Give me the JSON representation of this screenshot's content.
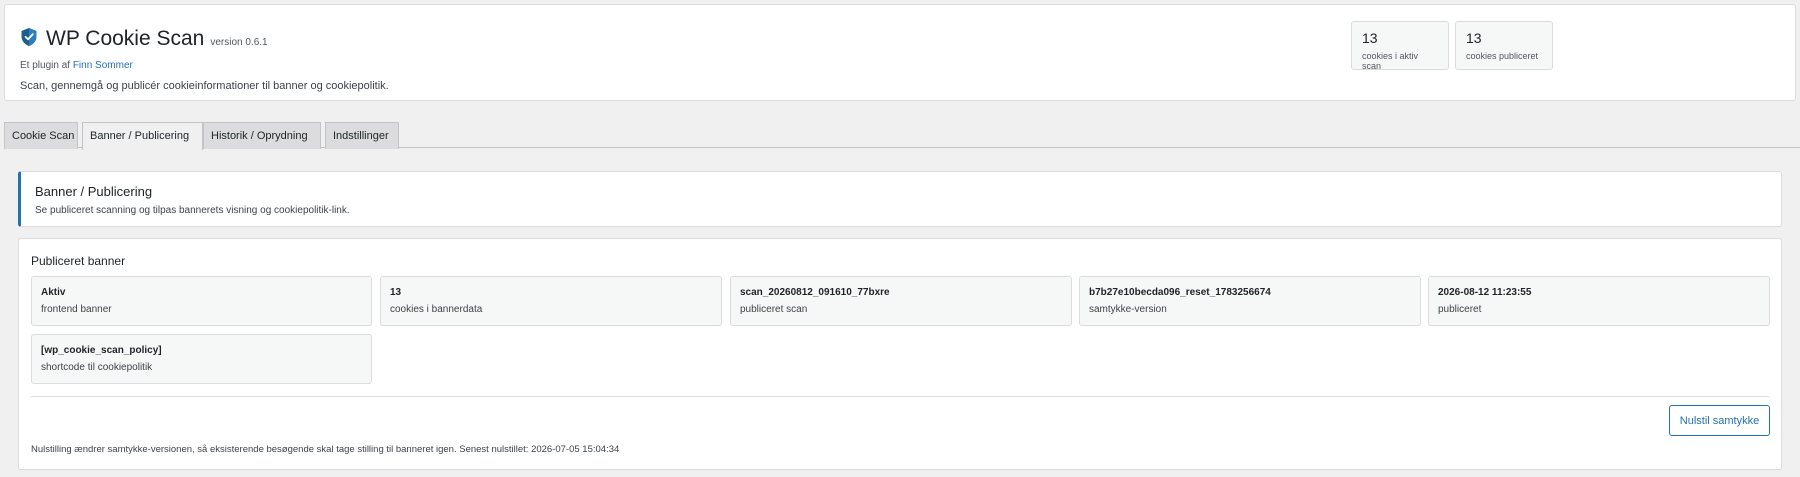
{
  "header": {
    "title": "WP Cookie Scan",
    "version": "version 0.6.1",
    "byline_prefix": "Et plugin af",
    "author": "Finn Sommer",
    "tagline": "Scan, gennemgå og publicér cookieinformationer til banner og cookiepolitik.",
    "icon": "shield-icon",
    "brand_color": "#2271b1"
  },
  "stats": [
    {
      "value": "13",
      "label": "cookies i aktiv scan"
    },
    {
      "value": "13",
      "label": "cookies publiceret"
    }
  ],
  "tabs": [
    {
      "label": "Cookie Scan"
    },
    {
      "label": "Banner / Publicering"
    },
    {
      "label": "Historik / Oprydning"
    },
    {
      "label": "Indstillinger"
    }
  ],
  "active_tab": "Banner / Publicering",
  "section": {
    "title": "Banner / Publicering",
    "description": "Se publiceret scanning og tilpas bannerets visning og cookiepolitik-link."
  },
  "published": {
    "title": "Publiceret banner",
    "tiles": [
      {
        "value": "Aktiv",
        "label": "frontend banner"
      },
      {
        "value": "13",
        "label": "cookies i bannerdata"
      },
      {
        "value": "scan_20260812_091610_77bxre",
        "label": "publiceret scan"
      },
      {
        "value": "b7b27e10becda096_reset_1783256674",
        "label": "samtykke-version"
      },
      {
        "value": "2026-08-12 11:23:55",
        "label": "publiceret"
      },
      {
        "value": "[wp_cookie_scan_policy]",
        "label": "shortcode til cookiepolitik"
      }
    ],
    "reset_button": "Nulstil samtykke",
    "note": "Nulstilling ændrer samtykke-versionen, så eksisterende besøgende skal tage stilling til banneret igen. Senest nulstillet: 2026-07-05 15:04:34"
  }
}
